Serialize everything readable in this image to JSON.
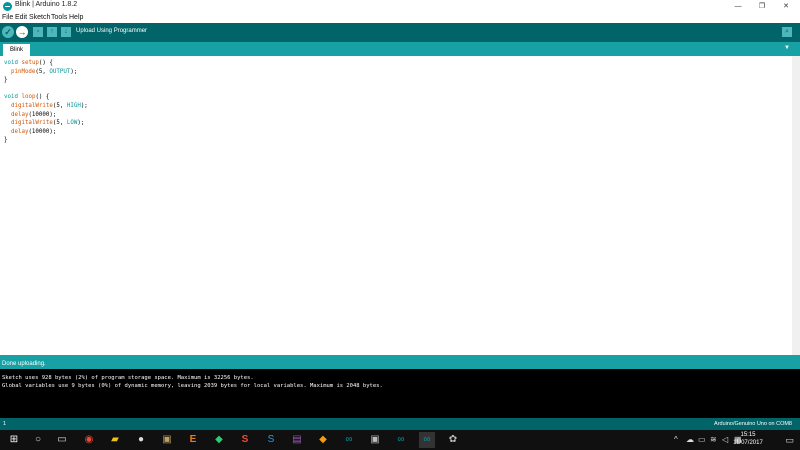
{
  "window": {
    "title": "Blink | Arduino 1.8.2",
    "minimize": "—",
    "maximize": "❐",
    "close": "✕"
  },
  "menu": [
    "File",
    "Edit",
    "Sketch",
    "Tools",
    "Help"
  ],
  "toolbar": {
    "verify_icon": "✓",
    "upload_icon": "→",
    "new_icon": "▫",
    "open_icon": "↑",
    "save_icon": "↓",
    "hover_label": "Upload Using Programmer",
    "serial_icon": "⌕"
  },
  "tabs": {
    "active": "Blink",
    "menu_icon": "▼"
  },
  "editor": {
    "lines": [
      "void setup() {",
      "  pinMode(5, OUTPUT);",
      "}",
      "",
      "void loop() {",
      "  digitalWrite(5, HIGH);",
      "  delay(10000);",
      "  digitalWrite(5, LOW);",
      "  delay(10000);",
      "}"
    ]
  },
  "console": {
    "status": "Done uploading.",
    "lines": [
      "Sketch uses 928 bytes (2%) of program storage space. Maximum is 32256 bytes.",
      "Global variables use 9 bytes (0%) of dynamic memory, leaving 2039 bytes for local variables. Maximum is 2048 bytes."
    ]
  },
  "statusbar": {
    "line": "1",
    "board": "Arduino/Genuino Uno on COM8"
  },
  "taskbar": {
    "clock_time": "15:15",
    "clock_date": "11/07/2017"
  },
  "colors": {
    "toolbar": "#006468",
    "tabbar": "#17a1a5",
    "accent": "#00979c",
    "console_bg": "#000000"
  }
}
